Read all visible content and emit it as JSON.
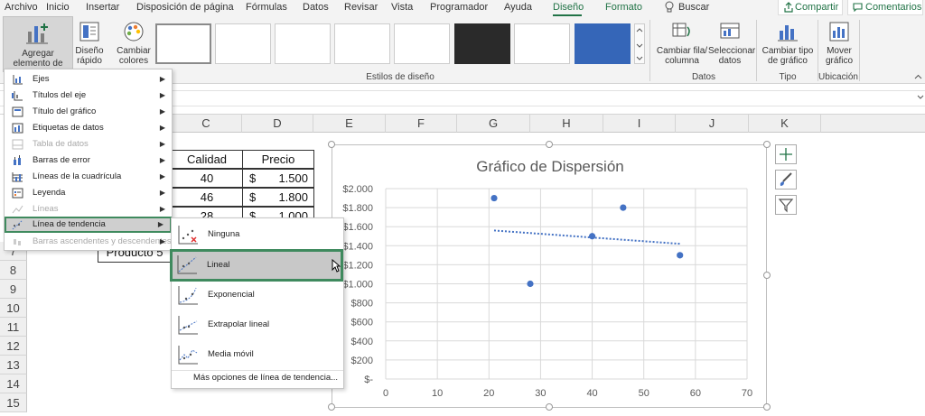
{
  "tabs": [
    "Archivo",
    "Inicio",
    "Insertar",
    "Disposición de página",
    "Fórmulas",
    "Datos",
    "Revisar",
    "Vista",
    "Programador",
    "Ayuda",
    "Diseño",
    "Formato"
  ],
  "active_tab": "Diseño",
  "search_label": "Buscar",
  "share_label": "Compartir",
  "comments_label": "Comentarios",
  "ribbon": {
    "add_element": "Agregar elemento de gráfico",
    "quick_layout": "Diseño rápido",
    "change_colors": "Cambiar colores",
    "styles_group": "Estilos de diseño",
    "switch_row_col": "Cambiar fila/ columna",
    "select_data": "Seleccionar datos",
    "data_group": "Datos",
    "change_type": "Cambiar tipo de gráfico",
    "type_group": "Tipo",
    "move_chart": "Mover gráfico",
    "location_group": "Ubicación"
  },
  "columns": [
    "C",
    "D",
    "E",
    "F",
    "G",
    "H",
    "I",
    "J",
    "K"
  ],
  "rows": [
    "7",
    "8",
    "9",
    "10",
    "11",
    "12",
    "13",
    "14",
    "15"
  ],
  "table": {
    "headers": [
      "Calidad",
      "Precio"
    ],
    "rows": [
      {
        "calidad": "40",
        "currency": "$",
        "precio": "1.500"
      },
      {
        "calidad": "46",
        "currency": "$",
        "precio": "1.800"
      },
      {
        "calidad": "28",
        "currency": "$",
        "precio": "1.000"
      }
    ],
    "product_label": "Producto 5"
  },
  "main_menu": [
    {
      "label": "Ejes",
      "icon": "axes-icon",
      "enabled": true
    },
    {
      "label": "Títulos del eje",
      "icon": "axis-titles-icon",
      "enabled": true
    },
    {
      "label": "Título del gráfico",
      "icon": "chart-title-icon",
      "enabled": true
    },
    {
      "label": "Etiquetas de datos",
      "icon": "data-labels-icon",
      "enabled": true
    },
    {
      "label": "Tabla de datos",
      "icon": "data-table-icon",
      "enabled": false
    },
    {
      "label": "Barras de error",
      "icon": "error-bars-icon",
      "enabled": true
    },
    {
      "label": "Líneas de la cuadrícula",
      "icon": "gridlines-icon",
      "enabled": true
    },
    {
      "label": "Leyenda",
      "icon": "legend-icon",
      "enabled": true
    },
    {
      "label": "Líneas",
      "icon": "lines-icon",
      "enabled": false
    },
    {
      "label": "Línea de tendencia",
      "icon": "trendline-icon",
      "enabled": true
    },
    {
      "label": "Barras ascendentes y descendentes",
      "icon": "up-down-bars-icon",
      "enabled": false
    }
  ],
  "submenu": [
    {
      "label": "Ninguna",
      "icon": "trendline-none-icon"
    },
    {
      "label": "Lineal",
      "icon": "trendline-linear-icon"
    },
    {
      "label": "Exponencial",
      "icon": "trendline-exponential-icon"
    },
    {
      "label": "Extrapolar lineal",
      "icon": "trendline-forecast-icon"
    },
    {
      "label": "Media móvil",
      "icon": "trendline-moving-average-icon"
    }
  ],
  "submenu_more": "Más opciones de línea de tendencia...",
  "chart_data": {
    "type": "scatter",
    "title": "Gráfico de Dispersión",
    "x": [
      21,
      28,
      40,
      46,
      57
    ],
    "y": [
      1900,
      1000,
      1500,
      1800,
      1300
    ],
    "xlim": [
      0,
      70
    ],
    "ylim": [
      0,
      2000
    ],
    "x_ticks": [
      "0",
      "10",
      "20",
      "30",
      "40",
      "50",
      "60",
      "70"
    ],
    "y_ticks": [
      "$-",
      "$200",
      "$400",
      "$600",
      "$800",
      "$1.000",
      "$1.200",
      "$1.400",
      "$1.600",
      "$1.800",
      "$2.000"
    ],
    "trendline": {
      "type": "linear",
      "from": [
        21,
        1560
      ],
      "to": [
        57,
        1420
      ]
    },
    "grid": true,
    "colors": {
      "points": "#4472c4",
      "trendline": "#4472c4"
    }
  },
  "colors": {
    "accent": "#217346",
    "highlight_border": "#3f8a5e"
  }
}
